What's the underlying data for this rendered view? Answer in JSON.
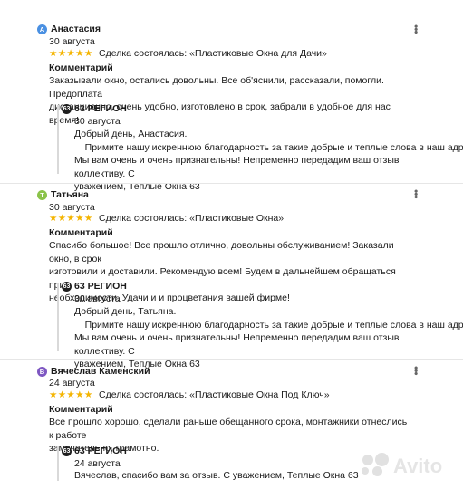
{
  "reviews": [
    {
      "initial": "А",
      "avatar_color": "#4a90e2",
      "author": "Анастасия",
      "date": "30 августа",
      "stars": "★★★★★",
      "deal_label": "Сделка состоялась: «Пластиковые Окна для Дачи»",
      "comment_heading": "Комментарий",
      "comment_lines": [
        "Заказывали окно, остались довольны. Все об'яснили, рассказали, помогли. Предоплата",
        "дистанционно, очень удобно, изготовлено в срок, забрали в удобное для нас время!"
      ],
      "reply": {
        "logo": "63",
        "name": "63 РЕГИОН",
        "date": "30 августа",
        "lines": [
          "Добрый день, Анастасия.",
          "    Примите нашу искреннюю благодарность за такие добрые и теплые слова в наш адрес.",
          "Мы вам очень и очень признательны! Непременно передадим ваш отзыв коллективу. С",
          "уважением, Теплые Окна 63"
        ]
      }
    },
    {
      "initial": "Т",
      "avatar_color": "#8bc34a",
      "author": "Татьяна",
      "date": "30 августа",
      "stars": "★★★★★",
      "deal_label": "Сделка состоялась: «Пластиковые Окна»",
      "comment_heading": "Комментарий",
      "comment_lines": [
        "Спасибо большое! Все прошло отлично, довольны обслуживанием! Заказали окно, в срок",
        "изготовили и доставили. Рекомендую всем! Будем в дальнейшем обращаться при",
        "необходимости. Удачи и и процветания вашей фирме!"
      ],
      "reply": {
        "logo": "63",
        "name": "63 РЕГИОН",
        "date": "30 августа",
        "lines": [
          "Добрый день, Татьяна.",
          "    Примите нашу искреннюю благодарность за такие добрые и теплые слова в наш адрес.",
          "Мы вам очень и очень признательны! Непременно передадим ваш отзыв коллективу. С",
          "уважением, Теплые Окна 63"
        ]
      }
    },
    {
      "initial": "В",
      "avatar_color": "#7e57c2",
      "author": "Вячеслав Каменский",
      "date": "24 августа",
      "stars": "★★★★★",
      "deal_label": "Сделка состоялась: «Пластиковые Окна Под Ключ»",
      "comment_heading": "Комментарий",
      "comment_lines": [
        "Все прошло хорошо, сделали раньше обещанного срока, монтажники отнеслись к работе",
        "замечательно, грамотно."
      ],
      "reply": {
        "logo": "63",
        "name": "63 РЕГИОН",
        "date": "24 августа",
        "lines": [
          "Вячеслав, спасибо вам за отзыв. С уважением, Теплые Окна 63"
        ]
      }
    }
  ],
  "watermark": {
    "text": "Avito"
  }
}
